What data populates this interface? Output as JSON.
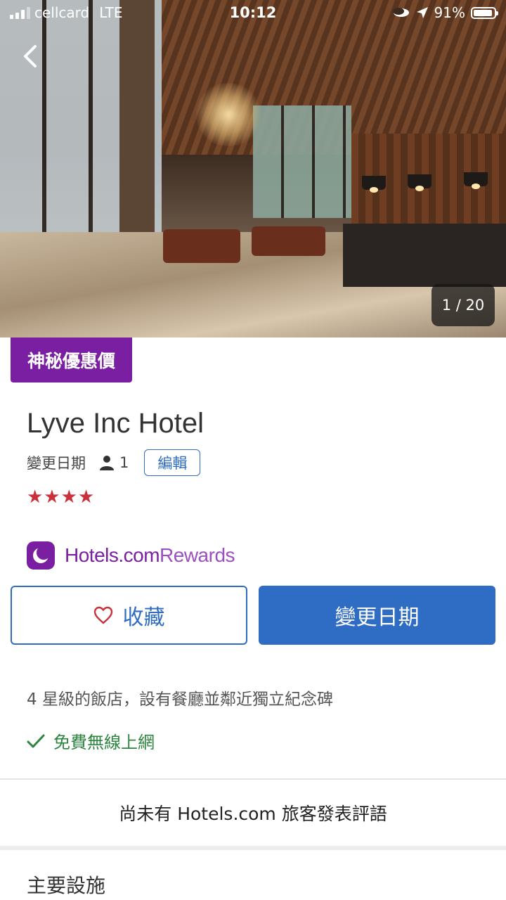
{
  "status_bar": {
    "carrier": "cellcard",
    "network": "LTE",
    "time": "10:12",
    "battery": "91%"
  },
  "gallery": {
    "counter": "1 / 20",
    "back_icon": "chevron-left-icon"
  },
  "badge": {
    "label": "神秘優惠價"
  },
  "hotel": {
    "name": "Lyve Inc Hotel",
    "change_dates_label": "變更日期",
    "guests": "1",
    "edit_label": "編輯",
    "stars": "★★★★",
    "star_count": 4,
    "description": "4 星級的飯店，設有餐廳並鄰近獨立紀念碑",
    "amenity_highlight": "免費無線上網"
  },
  "rewards": {
    "brand": "Hotels.com",
    "program": "Rewards"
  },
  "actions": {
    "save_label": "收藏",
    "change_dates_label": "變更日期"
  },
  "reviews": {
    "empty_message": "尚未有 Hotels.com 旅客發表評語"
  },
  "sections": {
    "main_amenities_title": "主要設施"
  },
  "colors": {
    "primary": "#2f6cc4",
    "badge_purple": "#7b1fa2",
    "star_red": "#c9303a",
    "success_green": "#2e8540"
  }
}
